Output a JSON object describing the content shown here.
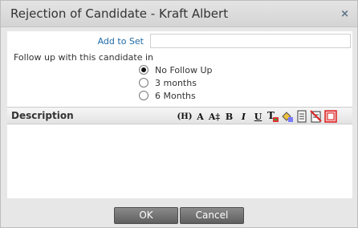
{
  "dialog": {
    "title": "Rejection of Candidate - Kraft Albert",
    "close_glyph": "×"
  },
  "add_to_set": {
    "label": "Add to Set",
    "value": "",
    "link_color": "#1e6aa6"
  },
  "follow_up": {
    "label": "Follow up with this candidate in",
    "options": [
      {
        "label": "No Follow Up",
        "selected": true
      },
      {
        "label": "3 months",
        "selected": false
      },
      {
        "label": "6 Months",
        "selected": false
      }
    ]
  },
  "description": {
    "label": "Description",
    "text": "",
    "toolbar": {
      "heading": "(H)",
      "font": "A",
      "font_size": "A‡",
      "bold": "B",
      "italic": "I",
      "underline": "U",
      "icons": [
        "heading-icon",
        "font-icon",
        "font-size-icon",
        "bold-icon",
        "italic-icon",
        "underline-icon",
        "text-color-icon",
        "background-color-icon",
        "document-icon",
        "clear-format-icon",
        "fullscreen-icon"
      ]
    }
  },
  "buttons": {
    "ok": "OK",
    "cancel": "Cancel"
  }
}
